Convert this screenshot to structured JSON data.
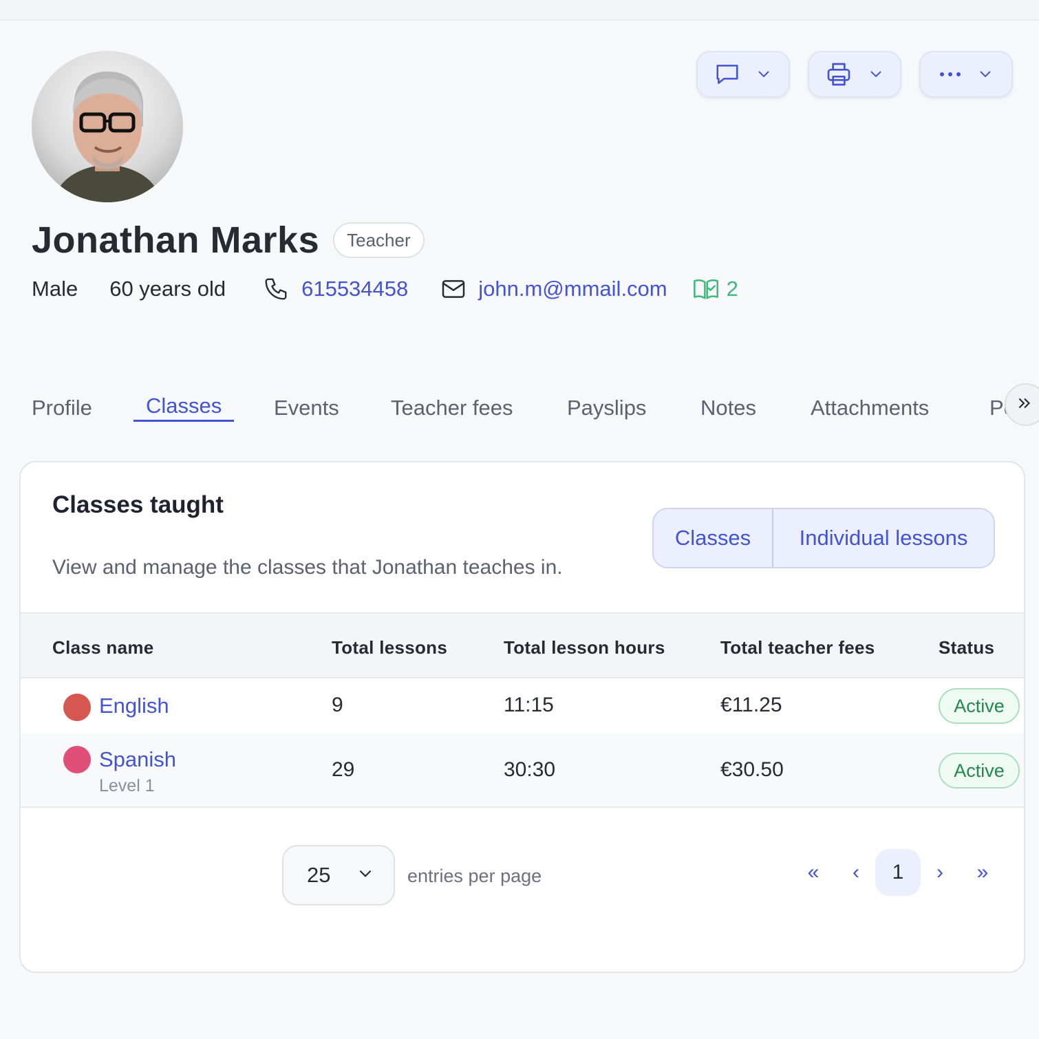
{
  "profile": {
    "name": "Jonathan Marks",
    "role": "Teacher",
    "gender": "Male",
    "age": "60 years old",
    "phone": "615534458",
    "email": "john.m@mmail.com",
    "classes_count": "2"
  },
  "tabs": [
    {
      "label": "Profile"
    },
    {
      "label": "Classes"
    },
    {
      "label": "Events"
    },
    {
      "label": "Teacher fees"
    },
    {
      "label": "Payslips"
    },
    {
      "label": "Notes"
    },
    {
      "label": "Attachments"
    },
    {
      "label": "Pe"
    }
  ],
  "active_tab": "Classes",
  "card": {
    "title": "Classes taught",
    "subtitle": "View and manage the classes that Jonathan teaches in.",
    "toggle": [
      "Classes",
      "Individual lessons"
    ]
  },
  "table": {
    "headers": [
      "Class name",
      "Total lessons",
      "Total lesson hours",
      "Total teacher fees",
      "Status"
    ],
    "rows": [
      {
        "name": "English",
        "level": "",
        "lessons": "9",
        "hours": "11:15",
        "fees": "€11.25",
        "status": "Active",
        "color": "#d5574f"
      },
      {
        "name": "Spanish",
        "level": "Level 1",
        "lessons": "29",
        "hours": "30:30",
        "fees": "€30.50",
        "status": "Active",
        "color": "#e04e7a"
      }
    ]
  },
  "pagination": {
    "per_page": "25",
    "per_page_label": "entries per page",
    "first": "«",
    "prev": "‹",
    "current": "1",
    "next": "›",
    "last": "»"
  },
  "colors": {
    "accent": "#4353d6",
    "status_active": "#23874f",
    "classes_icon": "#3db87a"
  }
}
